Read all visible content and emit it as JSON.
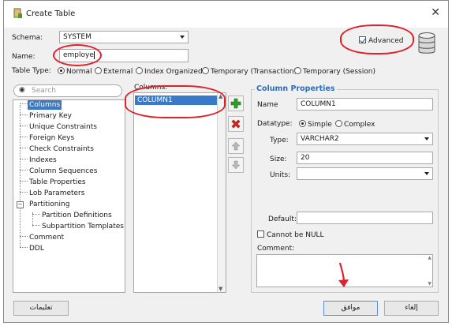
{
  "window": {
    "title": "Create Table"
  },
  "schema": {
    "label": "Schema:",
    "value": "SYSTEM"
  },
  "name": {
    "label": "Name:",
    "value": "employe"
  },
  "table_type": {
    "label": "Table Type:",
    "options": [
      "Normal",
      "External",
      "Index Organized",
      "Temporary (Transaction)",
      "Temporary (Session)"
    ],
    "selected": "Normal"
  },
  "advanced": {
    "label": "Advanced",
    "checked": true
  },
  "search": {
    "placeholder": "Search"
  },
  "tree": {
    "items": [
      "Columns",
      "Primary Key",
      "Unique Constraints",
      "Foreign Keys",
      "Check Constraints",
      "Indexes",
      "Column Sequences",
      "Table Properties",
      "Lob Parameters",
      "Partitioning",
      "Partition Definitions",
      "Subpartition Templates",
      "Comment",
      "DDL"
    ],
    "selected": "Columns"
  },
  "columns": {
    "label": "Columns:",
    "items": [
      "COLUMN1"
    ]
  },
  "column_properties": {
    "heading": "Column Properties",
    "name_label": "Name",
    "name_value": "COLUMN1",
    "datatype_label": "Datatype:",
    "datatype_simple": "Simple",
    "datatype_complex": "Complex",
    "type_label": "Type:",
    "type_value": "VARCHAR2",
    "size_label": "Size:",
    "size_value": "20",
    "units_label": "Units:",
    "units_value": "",
    "default_label": "Default:",
    "default_value": "",
    "notnull_label": "Cannot be NULL",
    "comment_label": "Comment:",
    "comment_value": ""
  },
  "buttons": {
    "help": "تعليمات",
    "ok": "موافق",
    "cancel": "إلغاء"
  },
  "colors": {
    "annotation": "#e0202a",
    "selection": "#3a78c9",
    "accent": "#2f6db5"
  }
}
